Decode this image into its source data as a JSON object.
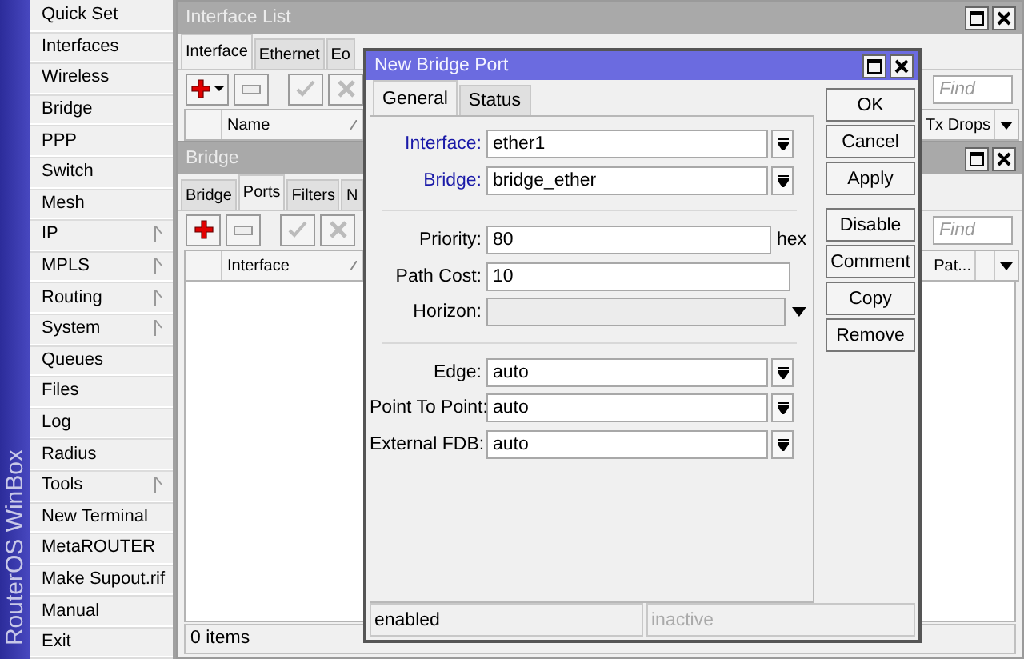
{
  "sidebar": {
    "brand": "RouterOS WinBox",
    "items": [
      {
        "label": "Quick Set",
        "submenu": false
      },
      {
        "label": "Interfaces",
        "submenu": false
      },
      {
        "label": "Wireless",
        "submenu": false
      },
      {
        "label": "Bridge",
        "submenu": false
      },
      {
        "label": "PPP",
        "submenu": false
      },
      {
        "label": "Switch",
        "submenu": false
      },
      {
        "label": "Mesh",
        "submenu": false
      },
      {
        "label": "IP",
        "submenu": true
      },
      {
        "label": "MPLS",
        "submenu": true
      },
      {
        "label": "Routing",
        "submenu": true
      },
      {
        "label": "System",
        "submenu": true
      },
      {
        "label": "Queues",
        "submenu": false
      },
      {
        "label": "Files",
        "submenu": false
      },
      {
        "label": "Log",
        "submenu": false
      },
      {
        "label": "Radius",
        "submenu": false
      },
      {
        "label": "Tools",
        "submenu": true
      },
      {
        "label": "New Terminal",
        "submenu": false
      },
      {
        "label": "MetaROUTER",
        "submenu": false
      },
      {
        "label": "Make Supout.rif",
        "submenu": false
      },
      {
        "label": "Manual",
        "submenu": false
      },
      {
        "label": "Exit",
        "submenu": false
      }
    ]
  },
  "interface_list": {
    "title": "Interface List",
    "tabs": [
      {
        "label": "Interface",
        "selected": true
      },
      {
        "label": "Ethernet",
        "selected": false
      },
      {
        "label": "Eo",
        "selected": false
      }
    ],
    "add_menu": true,
    "find": {
      "placeholder": "Find"
    },
    "columns": [
      {
        "label": "Name",
        "sorted": true
      },
      {
        "label": "Tx Drops",
        "sorted": false
      }
    ]
  },
  "bridge": {
    "title": "Bridge",
    "tabs": [
      {
        "label": "Bridge",
        "selected": false
      },
      {
        "label": "Ports",
        "selected": true
      },
      {
        "label": "Filters",
        "selected": false
      },
      {
        "label": "N",
        "selected": false
      }
    ],
    "add_menu": false,
    "find": {
      "placeholder": "Find"
    },
    "columns": [
      {
        "label": "Interface",
        "sorted": true
      },
      {
        "label": "Pat...",
        "sorted": false
      }
    ],
    "status": "0 items"
  },
  "dialog": {
    "title": "New Bridge Port",
    "tabs": [
      {
        "label": "General",
        "selected": true
      },
      {
        "label": "Status",
        "selected": false
      }
    ],
    "groups": [
      [
        {
          "kind": "select",
          "label": "Interface:",
          "value": "ether1",
          "emphasized": true
        },
        {
          "kind": "select",
          "label": "Bridge:",
          "value": "bridge_ether",
          "emphasized": true
        }
      ],
      [
        {
          "kind": "text",
          "label": "Priority:",
          "value": "80",
          "unit": "hex",
          "emphasized": false
        },
        {
          "kind": "text",
          "label": "Path Cost:",
          "value": "10",
          "emphasized": false
        },
        {
          "kind": "combo",
          "label": "Horizon:",
          "disabled": true,
          "emphasized": false
        }
      ],
      [
        {
          "kind": "select",
          "label": "Edge:",
          "value": "auto",
          "emphasized": false
        },
        {
          "kind": "select",
          "label": "Point To Point:",
          "value": "auto",
          "emphasized": false
        },
        {
          "kind": "select",
          "label": "External FDB:",
          "value": "auto",
          "emphasized": false
        }
      ]
    ],
    "buttons": [
      [
        "OK",
        "Cancel",
        "Apply"
      ],
      [
        "Disable",
        "Comment",
        "Copy",
        "Remove"
      ]
    ],
    "status": [
      {
        "text": "enabled",
        "dimmed": false
      },
      {
        "text": "inactive",
        "dimmed": true
      }
    ]
  }
}
